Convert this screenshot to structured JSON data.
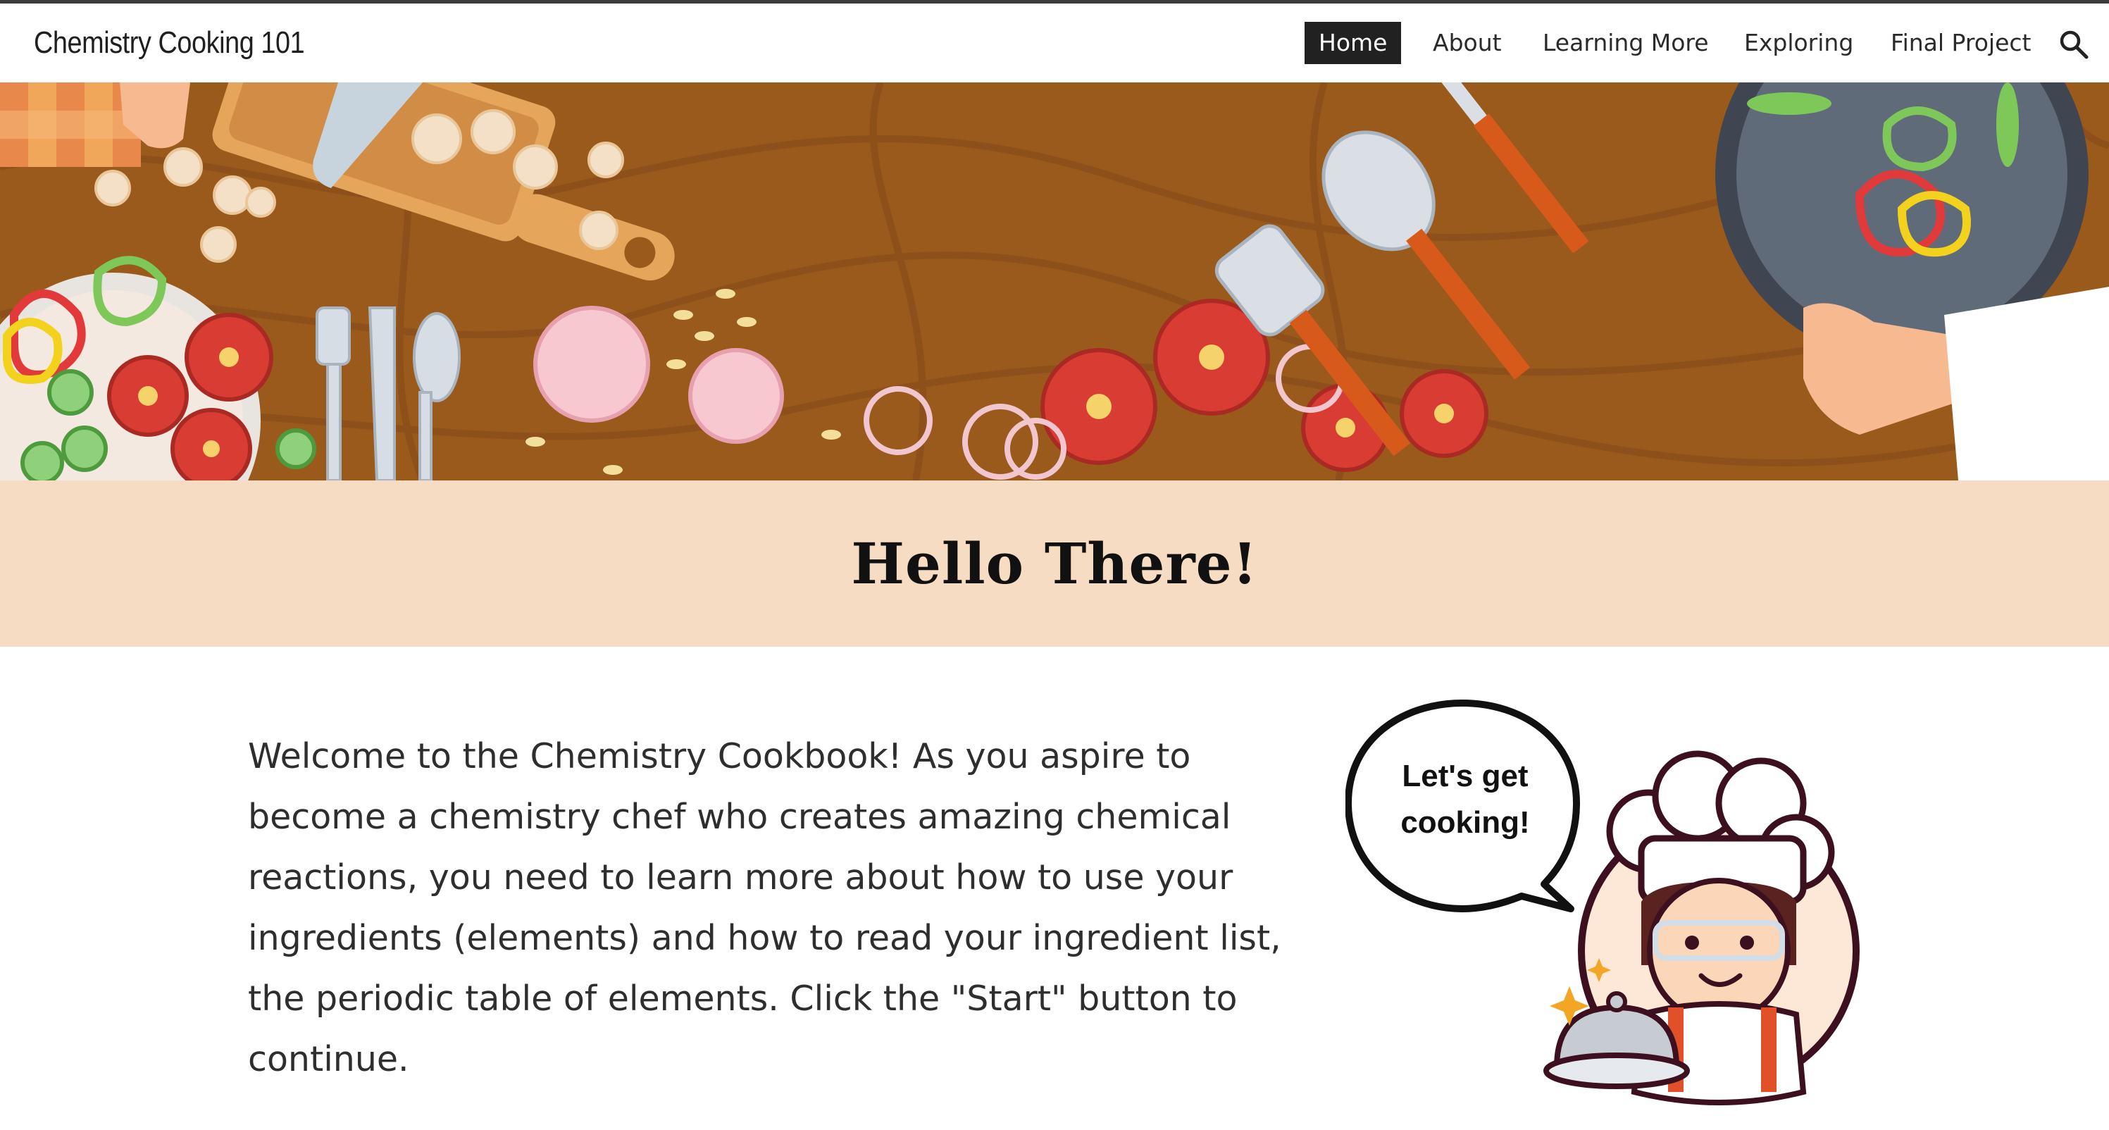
{
  "site": {
    "title": "Chemistry Cooking 101"
  },
  "nav": {
    "items": [
      {
        "label": "Home",
        "active": true
      },
      {
        "label": "About"
      },
      {
        "label": "Learning More"
      },
      {
        "label": "Exploring"
      },
      {
        "label": "Final Project"
      }
    ],
    "search_icon": "search-icon"
  },
  "banner": {
    "heading": "Hello There!"
  },
  "intro": {
    "text": "Welcome to the Chemistry Cookbook! As you aspire to become a chemistry chef who creates amazing chemical reactions, you need to learn more about how to use your ingredients (elements) and how to read your ingredient list, the periodic table of elements. Click the \"Start\" button to continue."
  },
  "chef": {
    "speech_line1": "Let's get",
    "speech_line2": "cooking!"
  },
  "colors": {
    "nav_active_bg": "#212121",
    "band_bg": "#f6dcc2",
    "wood": "#9a5a1c",
    "tomato": "#d93c33"
  }
}
